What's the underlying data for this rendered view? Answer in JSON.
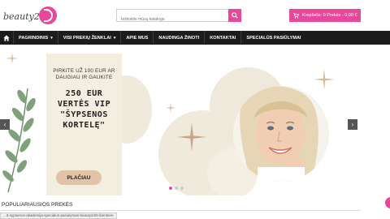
{
  "header": {
    "logo_text": "beauty24",
    "search_placeholder": "Ieškokite mūsų kataloge",
    "cart_label": "Krepšelis: 0 Prekės - 0,00 €"
  },
  "nav": {
    "items": [
      {
        "label": "PAGRINDINIS",
        "has_caret": true
      },
      {
        "label": "VISI PREKIŲ ŽENKLAI",
        "has_caret": true
      },
      {
        "label": "APIE MUS"
      },
      {
        "label": "NAUDINGA ŽINOTI"
      },
      {
        "label": "KONTAKTAI"
      },
      {
        "label": "SPECIALŪS PASIŪLYMAI"
      }
    ]
  },
  "slider": {
    "promo_top": "PIRKITE UŽ 100 EUR AR DAUGIAU IR GAUKITE",
    "promo_main_line1": "250 EUR",
    "promo_main_line2": "VERTĖS VIP",
    "promo_main_line3": "\"ŠYPSENOS",
    "promo_main_line4": "KORTELĘ\"",
    "button_label": "PLAČIAU",
    "prev_arrow": "‹",
    "next_arrow": "›",
    "slide_count": 3,
    "active_slide": 1
  },
  "section": {
    "title": "POPULIARIAUSIOS PREKĖS"
  },
  "status_bar": {
    "url": "...3-sypsenos-akademija-specialus-pasiulymas-beauty24/5-ibentiere"
  },
  "colors": {
    "accent": "#e8479a",
    "nav_bg": "#1c1c1c",
    "promo_bg": "#f3eedf",
    "button_bg": "#e2c3a8"
  }
}
